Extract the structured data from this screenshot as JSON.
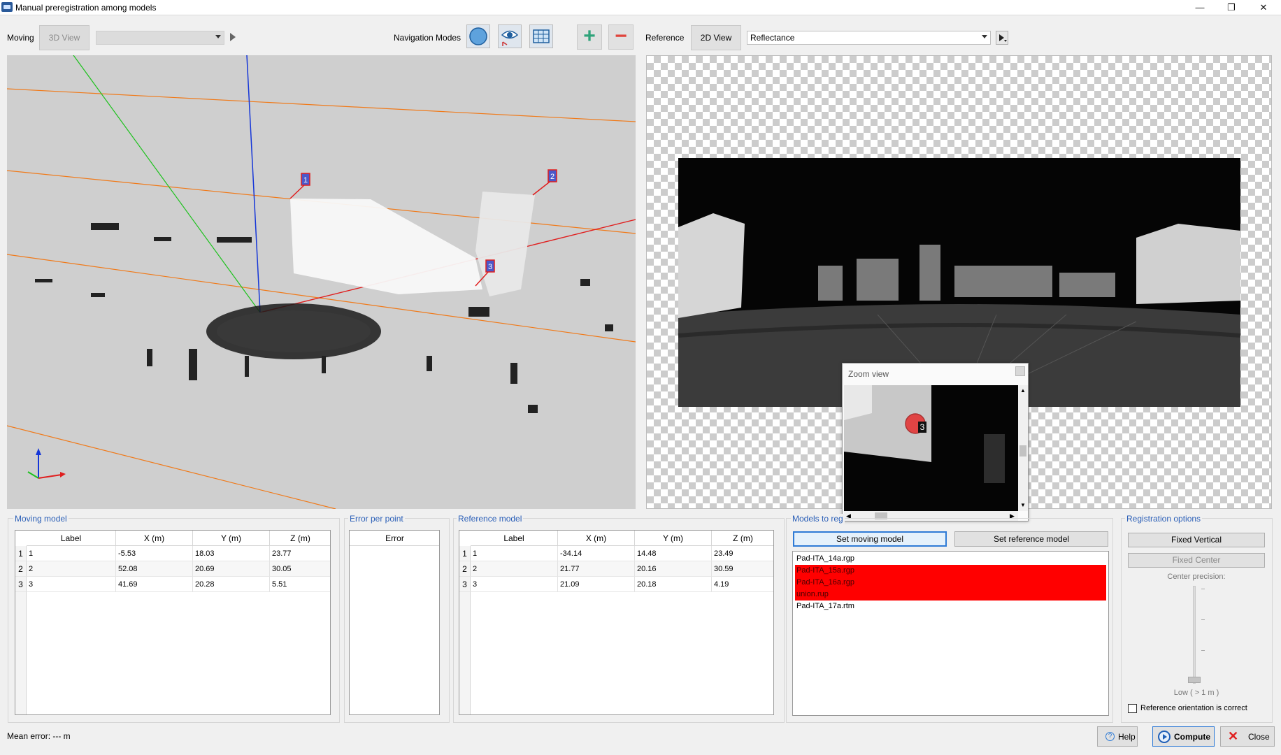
{
  "window": {
    "title": "Manual preregistration among models",
    "minimize": "—",
    "maximize": "❐",
    "close": "✕"
  },
  "toolbar": {
    "moving_label": "Moving",
    "moving_view_button": "3D View",
    "navigation_label": "Navigation Modes",
    "reference_label": "Reference",
    "reference_view_button": "2D View",
    "reference_combo_value": "Reflectance",
    "add_glyph": "+",
    "remove_glyph": "−"
  },
  "markers_3d": [
    "1",
    "2",
    "3"
  ],
  "zoom_view": {
    "title": "Zoom view",
    "marker": "3"
  },
  "moving_model": {
    "title": "Moving model",
    "columns": [
      "Label",
      "X (m)",
      "Y (m)",
      "Z (m)"
    ],
    "rows": [
      {
        "n": "1",
        "label": "1",
        "x": "-5.53",
        "y": "18.03",
        "z": "23.77"
      },
      {
        "n": "2",
        "label": "2",
        "x": "52.08",
        "y": "20.69",
        "z": "30.05"
      },
      {
        "n": "3",
        "label": "3",
        "x": "41.69",
        "y": "20.28",
        "z": "5.51"
      }
    ]
  },
  "error_per_point": {
    "title": "Error per point",
    "column": "Error"
  },
  "reference_model": {
    "title": "Reference model",
    "columns": [
      "Label",
      "X (m)",
      "Y (m)",
      "Z (m)"
    ],
    "rows": [
      {
        "n": "1",
        "label": "1",
        "x": "-34.14",
        "y": "14.48",
        "z": "23.49"
      },
      {
        "n": "2",
        "label": "2",
        "x": "21.77",
        "y": "20.16",
        "z": "30.59"
      },
      {
        "n": "3",
        "label": "3",
        "x": "21.09",
        "y": "20.18",
        "z": "4.19"
      }
    ]
  },
  "models_to_register": {
    "title": "Models to reg",
    "set_moving": "Set moving model",
    "set_reference": "Set reference model",
    "items": [
      "Pad-ITA_14a.rgp",
      "Pad-ITA_15a.rgp",
      "Pad-ITA_16a.rgp",
      "union.rup",
      "Pad-ITA_17a.rtm"
    ],
    "selected": [
      false,
      true,
      true,
      true,
      false
    ]
  },
  "registration_options": {
    "title": "Registration options",
    "fixed_vertical": "Fixed  Vertical",
    "fixed_center": "Fixed Center",
    "center_precision": "Center precision:",
    "slider_caption": "Low ( > 1 m )",
    "checkbox_label": "Reference orientation is correct",
    "checkbox_checked": false
  },
  "footer": {
    "mean_error": "Mean error: --- m",
    "help": "Help",
    "compute": "Compute",
    "close": "Close"
  }
}
